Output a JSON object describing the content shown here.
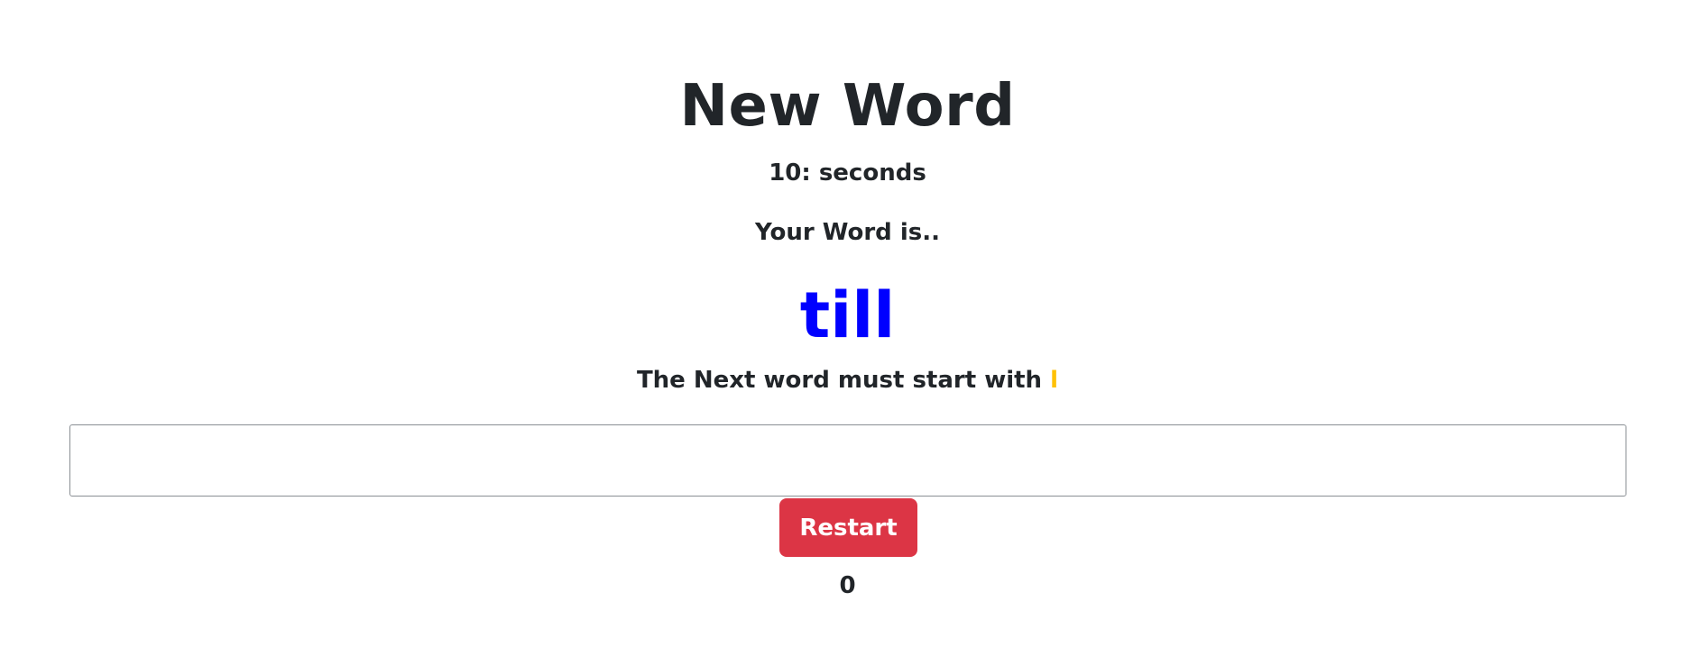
{
  "game": {
    "title": "New Word",
    "timer_text": "10: seconds",
    "prompt_text": "Your Word is..",
    "current_word": "till",
    "hint_text": "The Next word must start with ",
    "next_letter": "l",
    "input": {
      "value": "",
      "placeholder": ""
    },
    "restart_label": "Restart",
    "score": "0"
  },
  "colors": {
    "text": "#212529",
    "word": "#0000ff",
    "letter": "#ffc107",
    "button": "#dc3545",
    "button_text": "#ffffff"
  }
}
